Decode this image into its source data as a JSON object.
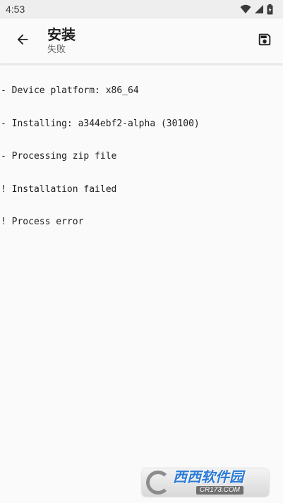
{
  "status_bar": {
    "time": "4:53",
    "icons": [
      "wifi-icon",
      "cellular-signal-icon",
      "battery-charging-icon"
    ]
  },
  "app_bar": {
    "back_icon": "arrow-back-icon",
    "title": "安装",
    "subtitle": "失败",
    "action_icon": "save-icon"
  },
  "log": {
    "lines": [
      "- Device platform: x86_64",
      "- Installing: a344ebf2-alpha (30100)",
      "- Processing zip file",
      "! Installation failed",
      "! Process error"
    ]
  },
  "watermark": {
    "name": "西西软件园",
    "domain": "CR173.COM"
  },
  "colors": {
    "status_bar_bg": "#eeeeee",
    "background": "#fafafa",
    "text_primary": "#212121",
    "watermark_blue": "#2b7bd6"
  }
}
